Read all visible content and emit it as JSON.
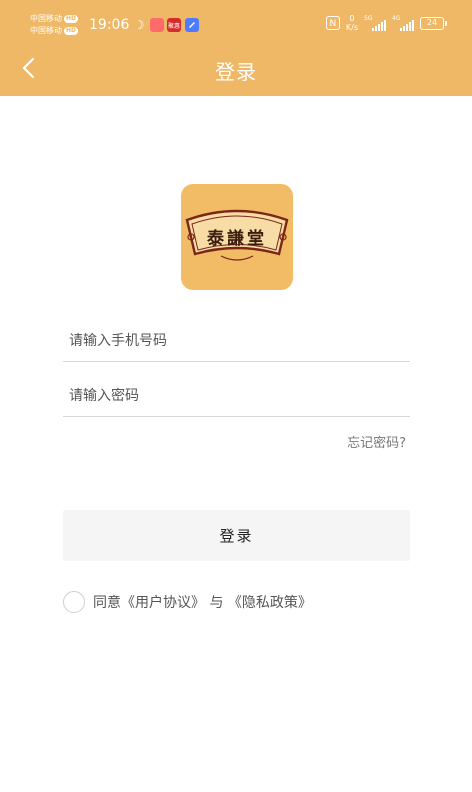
{
  "status_bar": {
    "carrier_1": "中国移动",
    "carrier_2": "中国移动",
    "hd_badge": "HD",
    "time": "19:06",
    "notification_badge": "聚惠",
    "net_speed_value": "0",
    "net_speed_unit": "K/s",
    "sim1_label": "5G",
    "sim2_label": "4G",
    "battery": "24",
    "icons": [
      "nfc-icon",
      "signal-icon",
      "battery-icon"
    ]
  },
  "nav": {
    "title": "登录",
    "back_icon": "chevron-left-icon"
  },
  "logo": {
    "text": "泰謙堂"
  },
  "form": {
    "phone_placeholder": "请输入手机号码",
    "phone_value": "",
    "password_placeholder": "请输入密码",
    "password_value": "",
    "forgot_label": "忘记密码?"
  },
  "login_button": "登录",
  "agreement": {
    "prefix": "同意",
    "user_agreement": "《用户协议》",
    "conjunction": " 与 ",
    "privacy_policy": "《隐私政策》"
  },
  "colors": {
    "brand": "#efb866",
    "button_bg": "#f5f5f5"
  }
}
